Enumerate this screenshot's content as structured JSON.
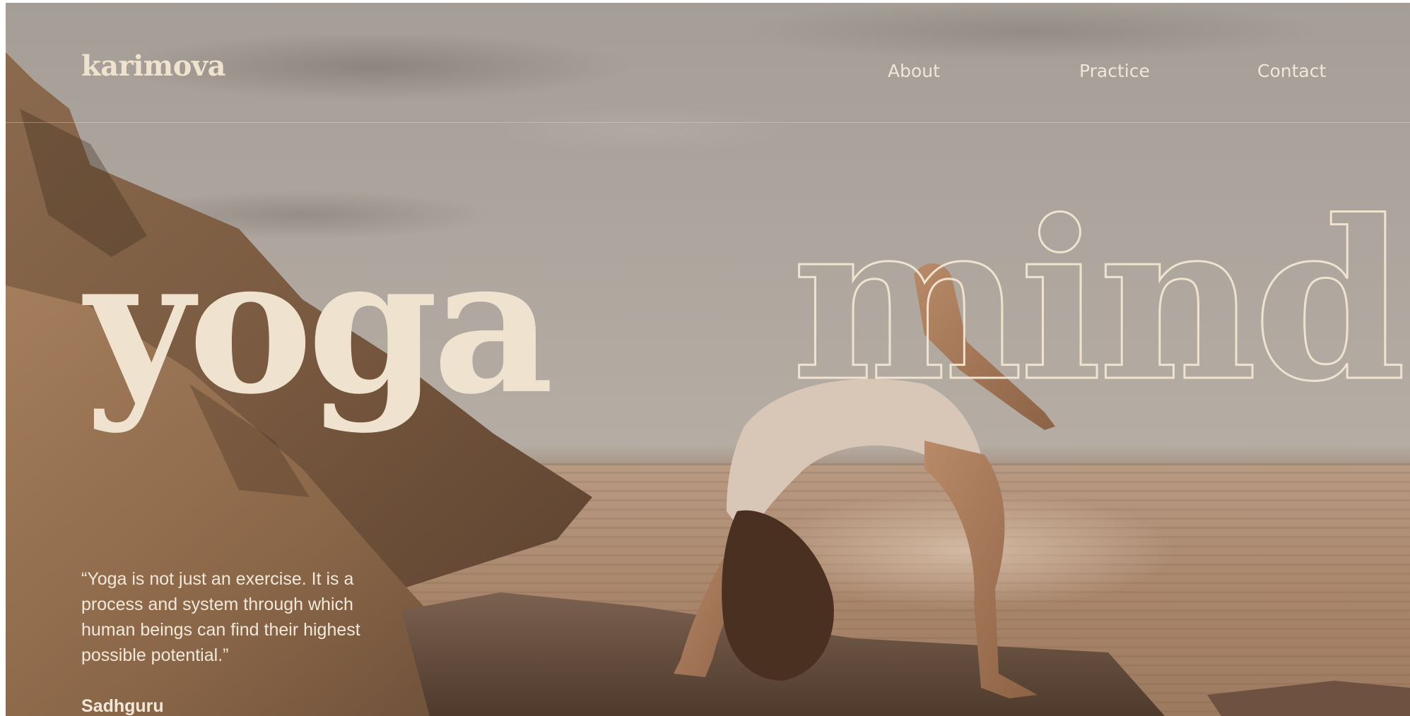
{
  "header": {
    "logo": "karimova",
    "nav": {
      "about": "About",
      "practice": "Practice",
      "contact": "Contact"
    }
  },
  "hero": {
    "title_solid": "yoga",
    "title_outline": "mind",
    "quote": "“Yoga is not just an exercise. It is a process and system through which human beings can find their highest possible potential.”",
    "author": "Sadhguru"
  },
  "colors": {
    "text_cream": "#efe3d0",
    "sky": "#ada59d",
    "rock": "#8a6446",
    "sea": "#a8856a"
  }
}
